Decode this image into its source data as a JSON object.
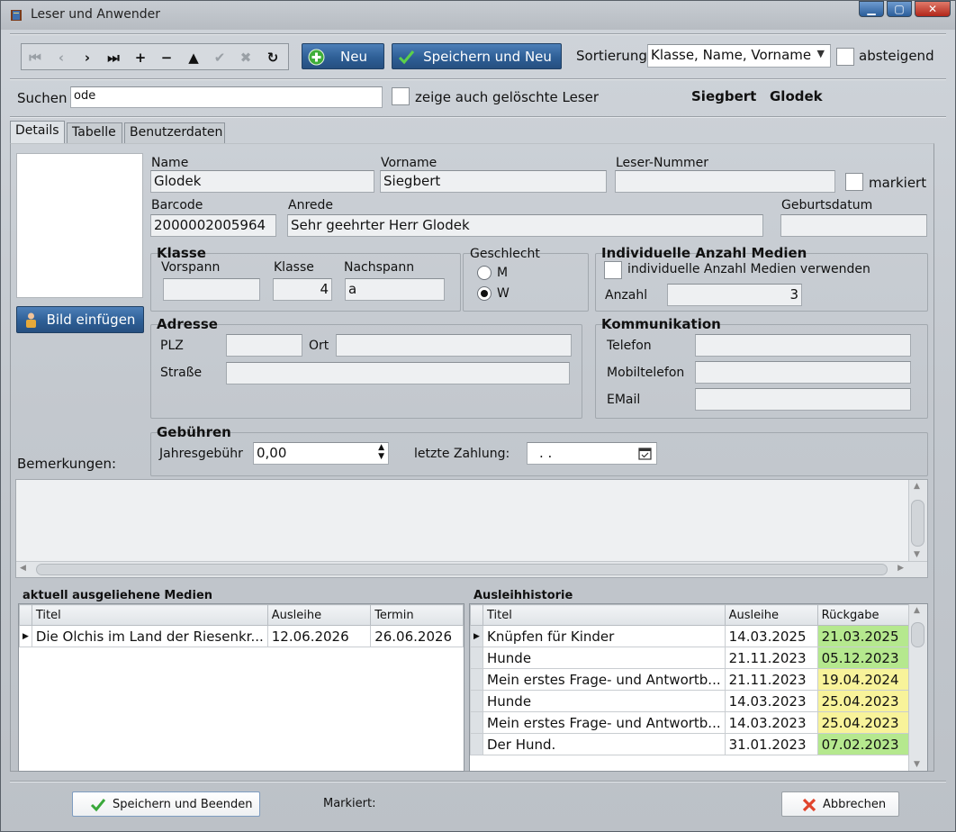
{
  "window": {
    "title": "Leser und Anwender"
  },
  "toolbar": {
    "nav_buttons": [
      "first",
      "prior",
      "next",
      "last",
      "insert",
      "delete",
      "edit",
      "post",
      "cancel",
      "refresh"
    ],
    "new_label": "Neu",
    "save_new_label": "Speichern und Neu",
    "sort_label": "Sortierung",
    "sort_value": "Klasse, Name, Vorname",
    "descending_label": "absteigend"
  },
  "search": {
    "label": "Suchen",
    "value": "ode",
    "show_deleted_label": "zeige auch gelöschte Leser",
    "current_first": "Siegbert",
    "current_last": "Glodek"
  },
  "tabs": [
    "Details",
    "Tabelle",
    "Benutzerdaten"
  ],
  "details": {
    "insert_image_label": "Bild einfügen",
    "name_label": "Name",
    "name_value": "Glodek",
    "vorname_label": "Vorname",
    "vorname_value": "Siegbert",
    "lesernr_label": "Leser-Nummer",
    "lesernr_value": "",
    "markiert_label": "markiert",
    "barcode_label": "Barcode",
    "barcode_value": "2000002005964",
    "anrede_label": "Anrede",
    "anrede_value": "Sehr geehrter Herr Glodek",
    "geburtsdatum_label": "Geburtsdatum",
    "geburtsdatum_value": "",
    "klasse": {
      "legend": "Klasse",
      "vorspann_label": "Vorspann",
      "vorspann_value": "",
      "klasse_label": "Klasse",
      "klasse_value": "4",
      "nachspann_label": "Nachspann",
      "nachspann_value": "a"
    },
    "geschlecht": {
      "legend": "Geschlecht",
      "m_label": "M",
      "w_label": "W",
      "selected": "W"
    },
    "anzahl": {
      "legend": "Individuelle Anzahl Medien",
      "checkbox_label": "individuelle Anzahl Medien verwenden",
      "anzahl_label": "Anzahl",
      "anzahl_value": "3"
    },
    "adresse": {
      "legend": "Adresse",
      "plz_label": "PLZ",
      "plz_value": "",
      "ort_label": "Ort",
      "ort_value": "",
      "strasse_label": "Straße",
      "strasse_value": ""
    },
    "kommunikation": {
      "legend": "Kommunikation",
      "telefon_label": "Telefon",
      "telefon_value": "",
      "mobil_label": "Mobiltelefon",
      "mobil_value": "",
      "email_label": "EMail",
      "email_value": ""
    },
    "gebuehren": {
      "legend": "Gebühren",
      "jahres_label": "Jahresgebühr",
      "jahres_value": "0,00",
      "zahlung_label": "letzte Zahlung:",
      "zahlung_value": ". ."
    },
    "bemerkungen_label": "Bemerkungen:"
  },
  "ausgeliehen": {
    "title": "aktuell ausgeliehene Medien",
    "columns": [
      "Titel",
      "Ausleihe",
      "Termin"
    ],
    "rows": [
      [
        "Die Olchis im Land der Riesenkr...",
        "12.06.2026",
        "26.06.2026"
      ]
    ]
  },
  "historie": {
    "title": "Ausleihhistorie",
    "columns": [
      "Titel",
      "Ausleihe",
      "Rückgabe"
    ],
    "rows": [
      [
        "Knüpfen für Kinder",
        "14.03.2025",
        "21.03.2025"
      ],
      [
        "Hunde",
        "21.11.2023",
        "05.12.2023"
      ],
      [
        "Mein erstes Frage- und Antwortb...",
        "21.11.2023",
        "19.04.2024"
      ],
      [
        "Hunde",
        "14.03.2023",
        "25.04.2023"
      ],
      [
        "Mein erstes Frage- und Antwortb...",
        "14.03.2023",
        "25.04.2023"
      ],
      [
        "Der Hund.",
        "31.01.2023",
        "07.02.2023"
      ]
    ],
    "row_status": [
      "green",
      "green",
      "yellow",
      "yellow",
      "yellow",
      "green"
    ],
    "status_colors": {
      "green": "#b5e88e",
      "yellow": "#f8f39a"
    }
  },
  "footer": {
    "save_close_label": "Speichern und Beenden",
    "markiert_label": "Markiert:",
    "cancel_label": "Abbrechen"
  }
}
